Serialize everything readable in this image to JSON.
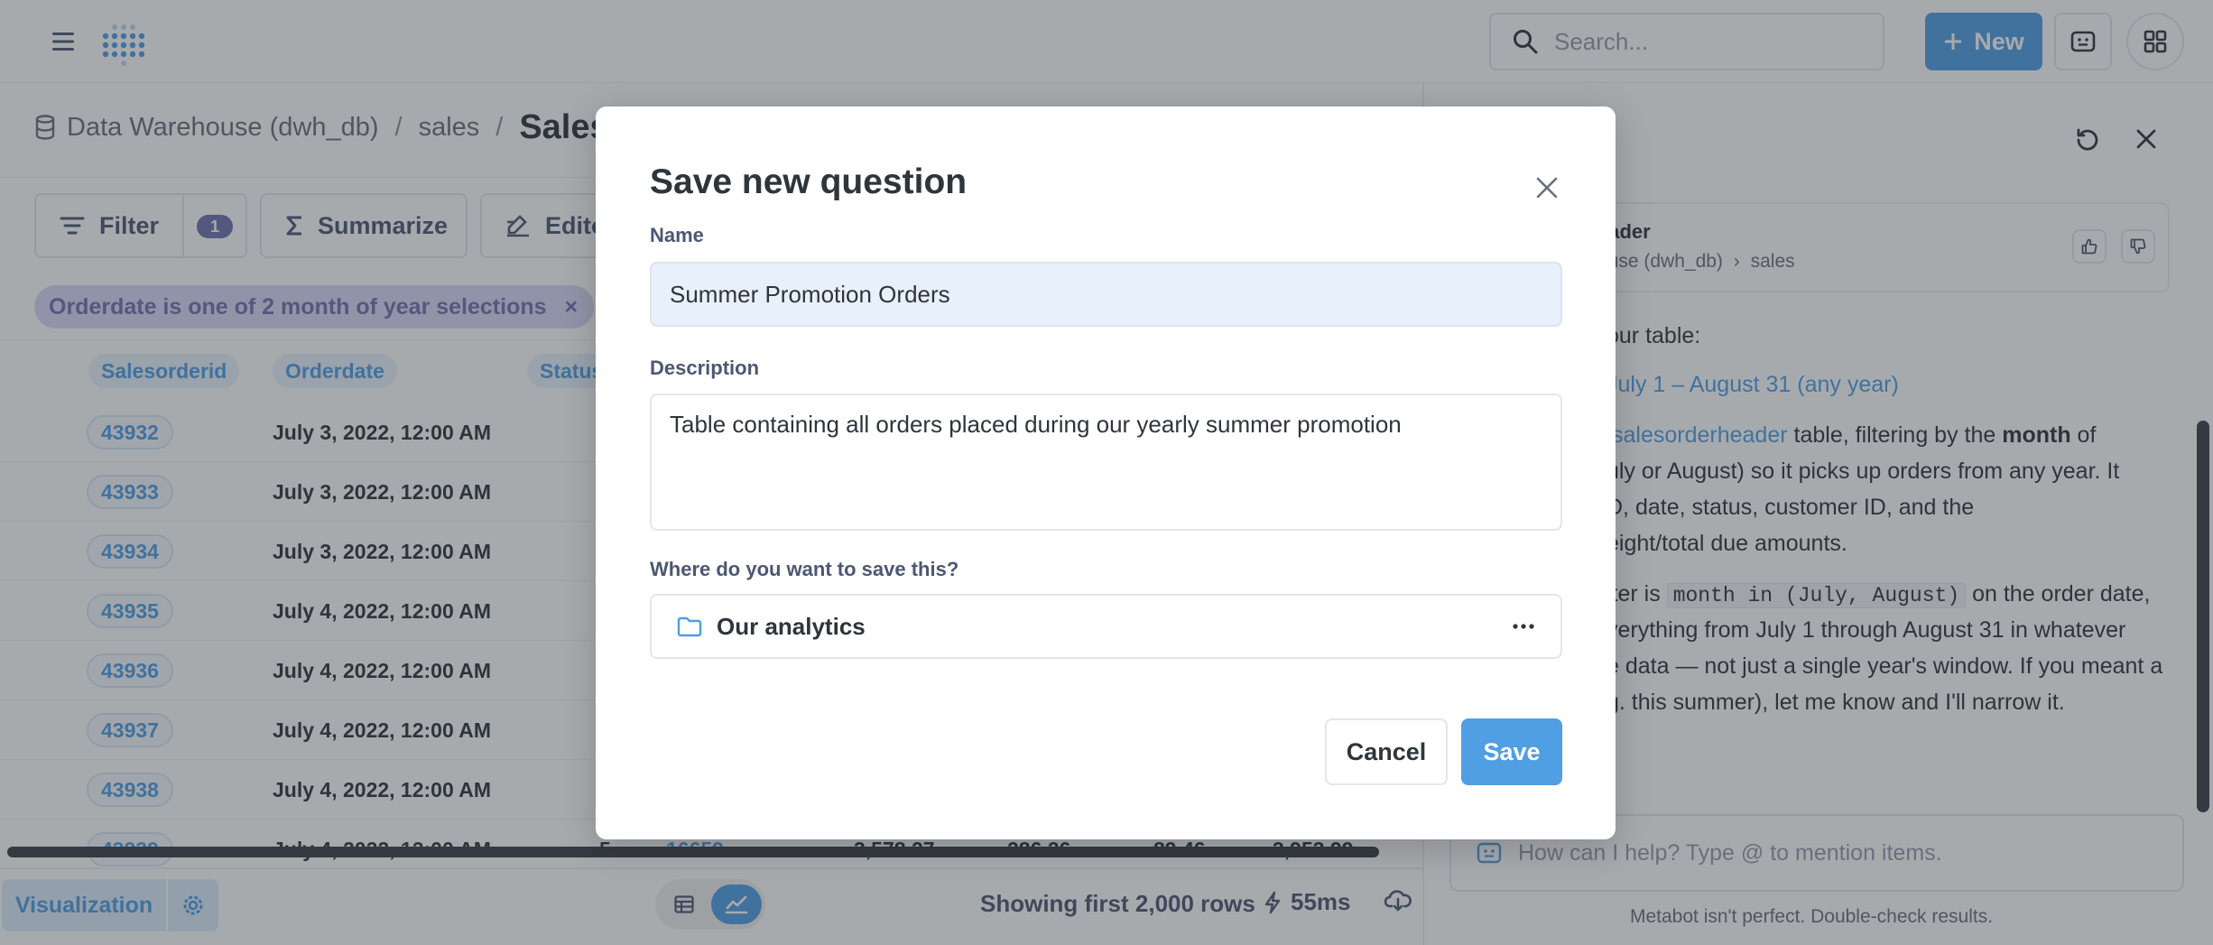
{
  "topnav": {
    "search_placeholder": "Search...",
    "new_label": "New"
  },
  "breadcrumb": {
    "database": "Data Warehouse (dwh_db)",
    "schema": "sales",
    "table": "Salesorderheader",
    "separator": "/"
  },
  "toolbar": {
    "filter_label": "Filter",
    "filter_count": "1",
    "summarize_label": "Summarize",
    "editor_label": "Editor"
  },
  "filter_pill": {
    "label": "Orderdate is one of 2 month of year selections",
    "remove": "×"
  },
  "table": {
    "columns": [
      "Salesorderid",
      "Orderdate",
      "Status"
    ],
    "rows": [
      {
        "id": "43932",
        "date": "July 3, 2022, 12:00 AM"
      },
      {
        "id": "43933",
        "date": "July 3, 2022, 12:00 AM"
      },
      {
        "id": "43934",
        "date": "July 3, 2022, 12:00 AM"
      },
      {
        "id": "43935",
        "date": "July 4, 2022, 12:00 AM"
      },
      {
        "id": "43936",
        "date": "July 4, 2022, 12:00 AM"
      },
      {
        "id": "43937",
        "date": "July 4, 2022, 12:00 AM"
      },
      {
        "id": "43938",
        "date": "July 4, 2022, 12:00 AM"
      },
      {
        "id": "43939",
        "date": "July 4, 2022, 12:00 AM",
        "status": "5",
        "customer": "16659",
        "subtotal": "3,578.27",
        "tax": "286.26",
        "freight": "89.46",
        "total": "3,953.99"
      }
    ]
  },
  "footer": {
    "visualization_label": "Visualization",
    "row_count": "Showing first 2,000 rows",
    "timing": "55ms"
  },
  "panel": {
    "source_title": "eader",
    "source_db": "ouse (dwh_db)",
    "source_schema": "sales",
    "line1": "our table:",
    "line2": "July 1 – August 31 (any year)",
    "line3_link": "salesorderheader",
    "line3_rest": " table, filtering by the ",
    "line3_bold": "month",
    "line3_end": " of",
    "line4": "uly or August) so it picks up orders from any year. It",
    "line5": "D, date, status, customer ID, and the",
    "line6": "eight/total due amounts.",
    "line7_pre": "lter is ",
    "line7_code": "month in (July, August)",
    "line7_post": " on the order date,",
    "line8": "verything from July 1 through August 31 in whatever",
    "line9": "e data — not just a single year's window. If you meant a",
    "line10": "g. this summer), let me know and I'll narrow it.",
    "chat_placeholder": "How can I help? Type @ to mention items.",
    "disclaimer": "Metabot isn't perfect. Double-check results."
  },
  "modal": {
    "title": "Save new question",
    "name_label": "Name",
    "name_value": "Summer Promotion Orders",
    "description_label": "Description",
    "description_value": "Table containing all orders placed during our yearly summer promotion",
    "location_label": "Where do you want to save this?",
    "collection": "Our analytics",
    "cancel_label": "Cancel",
    "save_label": "Save"
  },
  "colors": {
    "brand": "#509ee3",
    "filter": "#7172ad",
    "text_dark": "#2e353b",
    "overlay": "rgba(46,53,59,0.42)"
  },
  "icons": [
    "hamburger-icon",
    "metabase-logo",
    "search-icon",
    "plus-icon",
    "chat-icon",
    "grid-icon",
    "database-icon",
    "filter-icon",
    "sigma-icon",
    "pencil-icon",
    "close-icon",
    "gear-icon",
    "table-icon",
    "chart-icon",
    "bolt-icon",
    "download-icon",
    "refresh-icon",
    "thumbs-up-icon",
    "thumbs-down-icon",
    "metabot-icon",
    "folder-icon",
    "ellipsis-icon"
  ]
}
